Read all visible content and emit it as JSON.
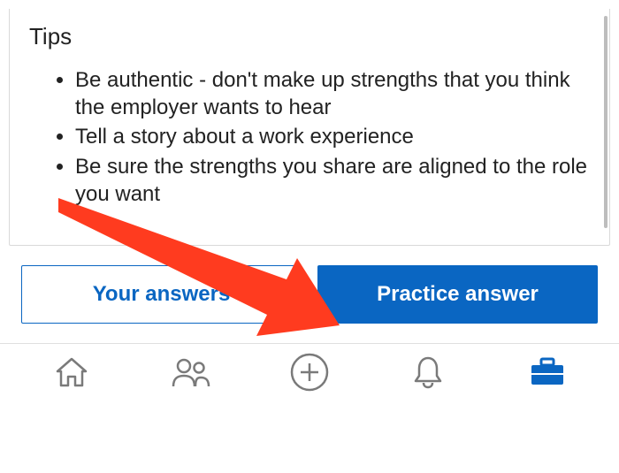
{
  "card": {
    "title": "Tips",
    "tips": [
      "Be authentic - don't make up strengths that you think the employer wants to hear",
      "Tell a story about a work experience",
      "Be sure the strengths you share are aligned to the role you want"
    ]
  },
  "buttons": {
    "your_answers": "Your answers",
    "practice_answer": "Practice answer"
  },
  "colors": {
    "accent": "#0a66c2",
    "arrow": "#ff3b1f",
    "nav_inactive": "#7a7a7a",
    "nav_active": "#0a66c2"
  },
  "nav": {
    "items": [
      "home",
      "people",
      "add",
      "notifications",
      "jobs"
    ],
    "active": "jobs"
  }
}
